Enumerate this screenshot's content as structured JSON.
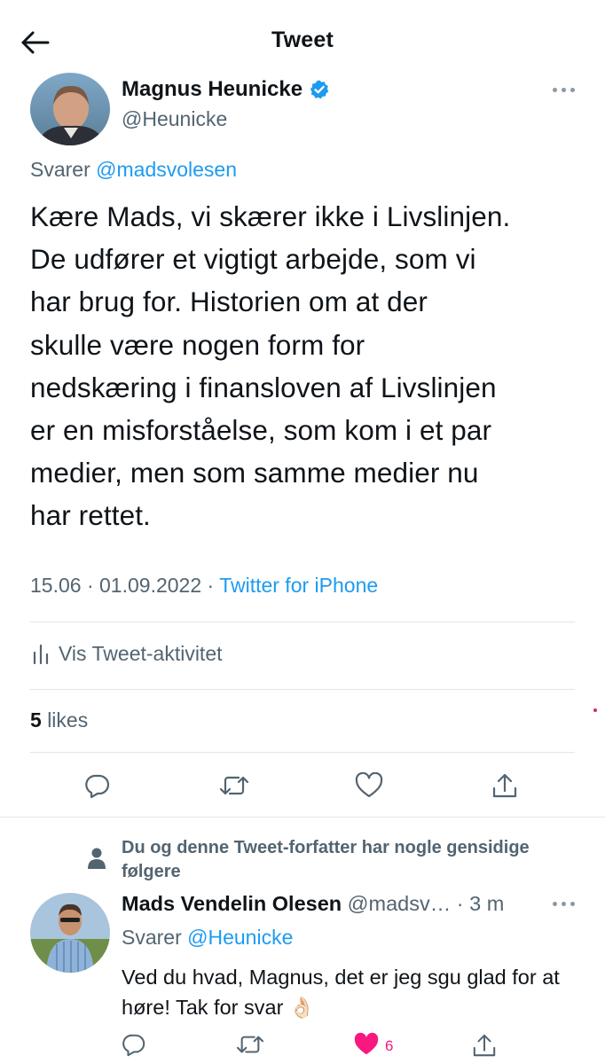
{
  "header": {
    "title": "Tweet"
  },
  "tweet": {
    "author_name": "Magnus Heunicke",
    "author_handle": "@Heunicke",
    "replying_prefix": "Svarer",
    "replying_mention": "@madsvolesen",
    "text_lines": [
      "Kære Mads, vi skærer ikke i Livslinjen.",
      "De udfører et vigtigt arbejde, som vi",
      "har brug for. Historien om at der",
      "skulle være nogen form for",
      "nedskæring i finansloven af Livslinjen",
      "er en misforståelse, som kom i et par",
      "medier, men som samme medier nu",
      "har rettet."
    ],
    "time": "15.06",
    "date": "01.09.2022",
    "separator": "·",
    "source": "Twitter for iPhone",
    "activity_label": "Vis Tweet-aktivitet",
    "likes_count": "5",
    "likes_label": "likes",
    "icons": [
      "reply-icon",
      "retweet-icon",
      "like-icon",
      "share-icon"
    ]
  },
  "reply": {
    "social_context": "Du og denne Tweet-forfatter har nogle gensidige følgere",
    "author_name": "Mads Vendelin Olesen",
    "author_handle": "@madsv…",
    "time_ago": "3 m",
    "replying_prefix": "Svarer",
    "replying_mention": "@Heunicke",
    "text": "Ved du hvad, Magnus, det er jeg sgu glad for at høre! Tak for svar 👌🏻",
    "like_count": "6"
  },
  "colors": {
    "accent": "#1d9bf0",
    "text": "#0f1419",
    "muted": "#536471",
    "like": "#f91880",
    "divider": "#e1e6ea"
  }
}
